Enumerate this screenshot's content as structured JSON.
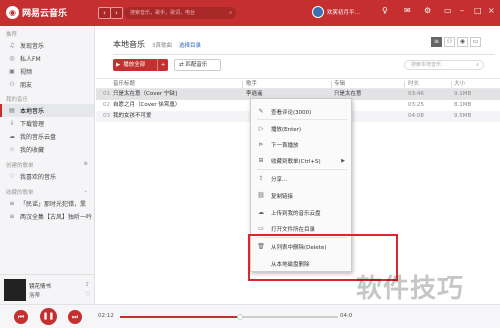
{
  "app": {
    "name": "网易云音乐",
    "search_placeholder": "搜索音乐，歌手，歌词，电台",
    "username": "欢笑初月平…"
  },
  "sidebar": {
    "recommend_title": "推荐",
    "recommend_items": [
      {
        "label": "发现音乐",
        "icon": "music-note-icon"
      },
      {
        "label": "私人FM",
        "icon": "radio-icon"
      },
      {
        "label": "视频",
        "icon": "video-icon"
      },
      {
        "label": "朋友",
        "icon": "friends-icon"
      }
    ],
    "mymusic_title": "我的音乐",
    "mymusic_items": [
      {
        "label": "本地音乐",
        "icon": "local-music-icon",
        "active": true
      },
      {
        "label": "下载管理",
        "icon": "download-icon"
      },
      {
        "label": "我的音乐云盘",
        "icon": "cloud-icon"
      },
      {
        "label": "我的收藏",
        "icon": "collection-icon"
      }
    ],
    "created_title": "创建的歌单",
    "created_items": [
      {
        "label": "我喜欢的音乐",
        "icon": "heart-icon"
      }
    ],
    "collected_title": "收藏的歌单",
    "collected_items": [
      {
        "label": "「民谣」那时光犯错，熏",
        "icon": "playlist-icon"
      },
      {
        "label": "两汉全集【古风】独听一吟",
        "icon": "playlist-icon"
      }
    ]
  },
  "now_playing": {
    "title": "镜花情书",
    "artist": "洛蒂"
  },
  "main": {
    "title": "本地音乐",
    "count": "3首歌曲",
    "select_dir": "选择目录",
    "play_all": "播放全部",
    "match": "匹配音乐",
    "search_placeholder": "搜索本地音乐"
  },
  "table": {
    "headers": {
      "title": "音乐标题",
      "artist": "歌手",
      "album": "专辑",
      "time": "时长",
      "size": "大小"
    },
    "rows": [
      {
        "idx": "01",
        "title": "只是太在意（Cover 宁缺]",
        "artist": "李逍遥",
        "album": "只是太在意",
        "time": "03:46",
        "size": "9.1MB"
      },
      {
        "idx": "02",
        "title": "自愿之月（Cover 徐霄凰）",
        "artist": "",
        "album": "",
        "time": "03:25",
        "size": "8.1MB"
      },
      {
        "idx": "03",
        "title": "我的女孩不可爱",
        "artist": "",
        "album": "不可爱",
        "time": "04:08",
        "size": "9.5MB"
      }
    ]
  },
  "context_menu": {
    "items": [
      {
        "label": "查看评论(3000)",
        "icon": "comment-icon"
      },
      {
        "label": "播放(Enter)",
        "icon": "play-icon"
      },
      {
        "label": "下一首播放",
        "icon": "next-play-icon"
      },
      {
        "label": "收藏到歌单(Ctrl+S)",
        "icon": "add-folder-icon",
        "submenu": true
      },
      {
        "label": "分享...",
        "icon": "share-icon"
      },
      {
        "label": "复制链接",
        "icon": "link-icon"
      },
      {
        "label": "上传到我的音乐云盘",
        "icon": "upload-cloud-icon"
      },
      {
        "label": "打开文件所在目录",
        "icon": "folder-icon"
      },
      {
        "label": "从列表中删除(Delete)",
        "icon": "trash-icon"
      },
      {
        "label": "从本地磁盘删除",
        "icon": ""
      }
    ]
  },
  "player": {
    "current_time": "02:12",
    "total_time": "04:0",
    "progress": 0.55
  },
  "watermark": "软件技巧",
  "colors": {
    "brand_red": "#c62f2f",
    "highlight_red": "#d8282a"
  }
}
